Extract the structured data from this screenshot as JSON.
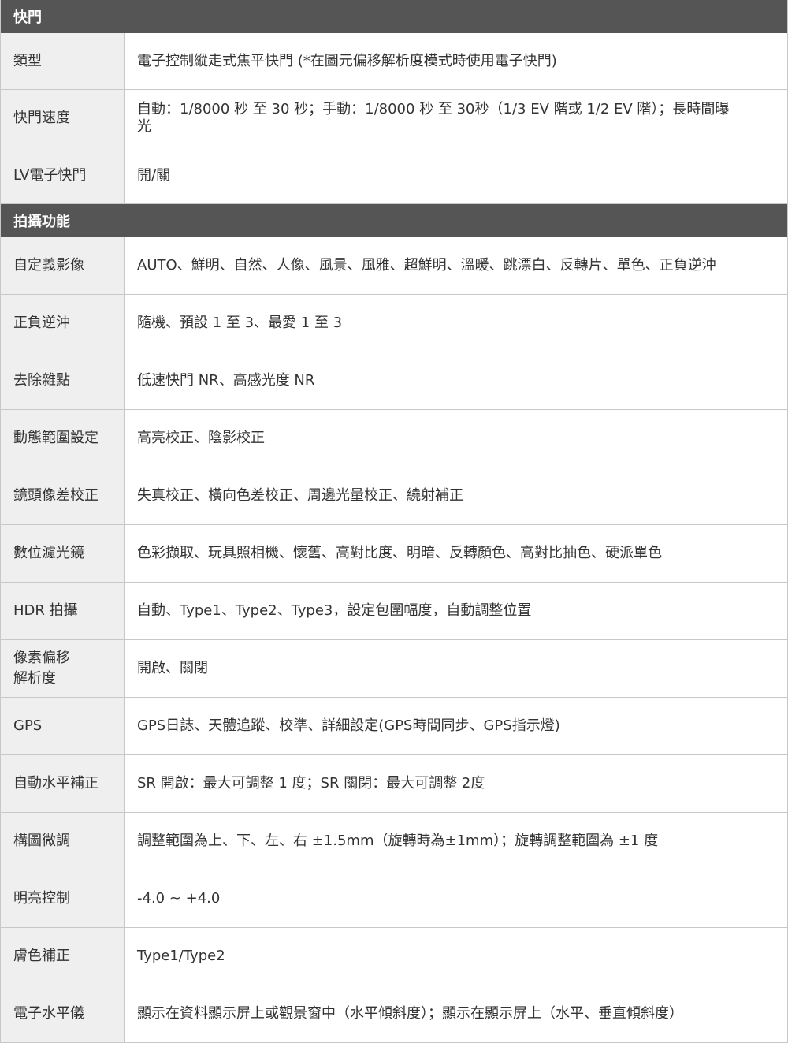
{
  "sections": [
    {
      "title": "快門",
      "rows": [
        {
          "label": "類型",
          "value": "電子控制縱走式焦平快門 (*在圖元偏移解析度模式時使用電子快門)"
        },
        {
          "label": "快門速度",
          "value": "自動：1/8000 秒 至 30 秒；手動：1/8000 秒 至 30秒（1/3 EV 階或 1/2 EV 階）；長時間曝光"
        },
        {
          "label": "LV電子快門",
          "value": "開/關"
        }
      ]
    },
    {
      "title": "拍攝功能",
      "rows": [
        {
          "label": "自定義影像",
          "value": "AUTO、鮮明、自然、人像、風景、風雅、超鮮明、溫暖、跳漂白、反轉片、單色、正負逆沖"
        },
        {
          "label": "正負逆沖",
          "value": "隨機、預設 1 至 3、最愛 1 至 3"
        },
        {
          "label": "去除雜點",
          "value": "低速快門 NR、高感光度 NR"
        },
        {
          "label": "動態範圍設定",
          "value": "高亮校正、陰影校正"
        },
        {
          "label": "鏡頭像差校正",
          "value": "失真校正、橫向色差校正、周邊光量校正、繞射補正"
        },
        {
          "label": "數位濾光鏡",
          "value": "色彩擷取、玩具照相機、懷舊、高對比度、明暗、反轉顏色、高對比抽色、硬派單色"
        },
        {
          "label": "HDR 拍攝",
          "value": "自動、Type1、Type2、Type3，設定包圍幅度，自動調整位置"
        },
        {
          "label": "像素偏移\n解析度",
          "value": "開啟、關閉"
        },
        {
          "label": "GPS",
          "value": "GPS日誌、天體追蹤、校準、詳細設定(GPS時間同步、GPS指示燈)"
        },
        {
          "label": "自動水平補正",
          "value": "SR 開啟：最大可調整 1 度；SR 關閉：最大可調整 2度"
        },
        {
          "label": "構圖微調",
          "value": "調整範圍為上、下、左、右 ±1.5mm（旋轉時為±1mm）；旋轉調整範圍為 ±1 度"
        },
        {
          "label": "明亮控制",
          "value": "-4.0 ~ +4.0"
        },
        {
          "label": "膚色補正",
          "value": "Type1/Type2"
        },
        {
          "label": "電子水平儀",
          "value": "顯示在資料顯示屏上或觀景窗中（水平傾斜度）；顯示在顯示屏上（水平、垂直傾斜度）"
        }
      ]
    }
  ]
}
